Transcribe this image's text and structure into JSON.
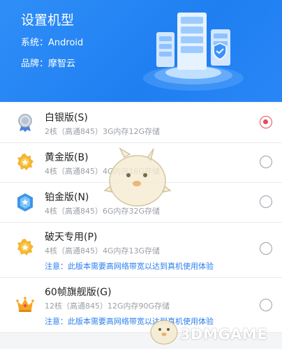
{
  "header": {
    "title": "设置机型",
    "system": "系统：Android",
    "brand": "品牌：摩智云"
  },
  "plans": [
    {
      "name": "白银版(S)",
      "spec": "2核（高通845）3G内存12G存储",
      "note": "",
      "badge_icon": "silver-medal-icon",
      "selected": true
    },
    {
      "name": "黄金版(B)",
      "spec": "4核（高通845）4G内存16G存储",
      "note": "",
      "badge_icon": "gold-badge-icon",
      "selected": false
    },
    {
      "name": "铂金版(N)",
      "spec": "4核（高通845）6G内存32G存储",
      "note": "",
      "badge_icon": "platinum-badge-icon",
      "selected": false
    },
    {
      "name": "破天专用(P)",
      "spec": "4核（高通845）4G内存13G存储",
      "note": "注意：此版本需要高网络带宽以达到真机使用体验",
      "badge_icon": "gold-badge-icon",
      "selected": false
    },
    {
      "name": "60帧旗舰版(G)",
      "spec": "12核（高通845）12G内存90G存储",
      "note": "注意：此版本需要高网络带宽以达到真机使用体验",
      "badge_icon": "crown-icon",
      "selected": false
    }
  ],
  "watermark": "3DMGAME",
  "colors": {
    "header": "#2a86f6",
    "selected": "#e94b5b",
    "note": "#2a7ff0"
  }
}
